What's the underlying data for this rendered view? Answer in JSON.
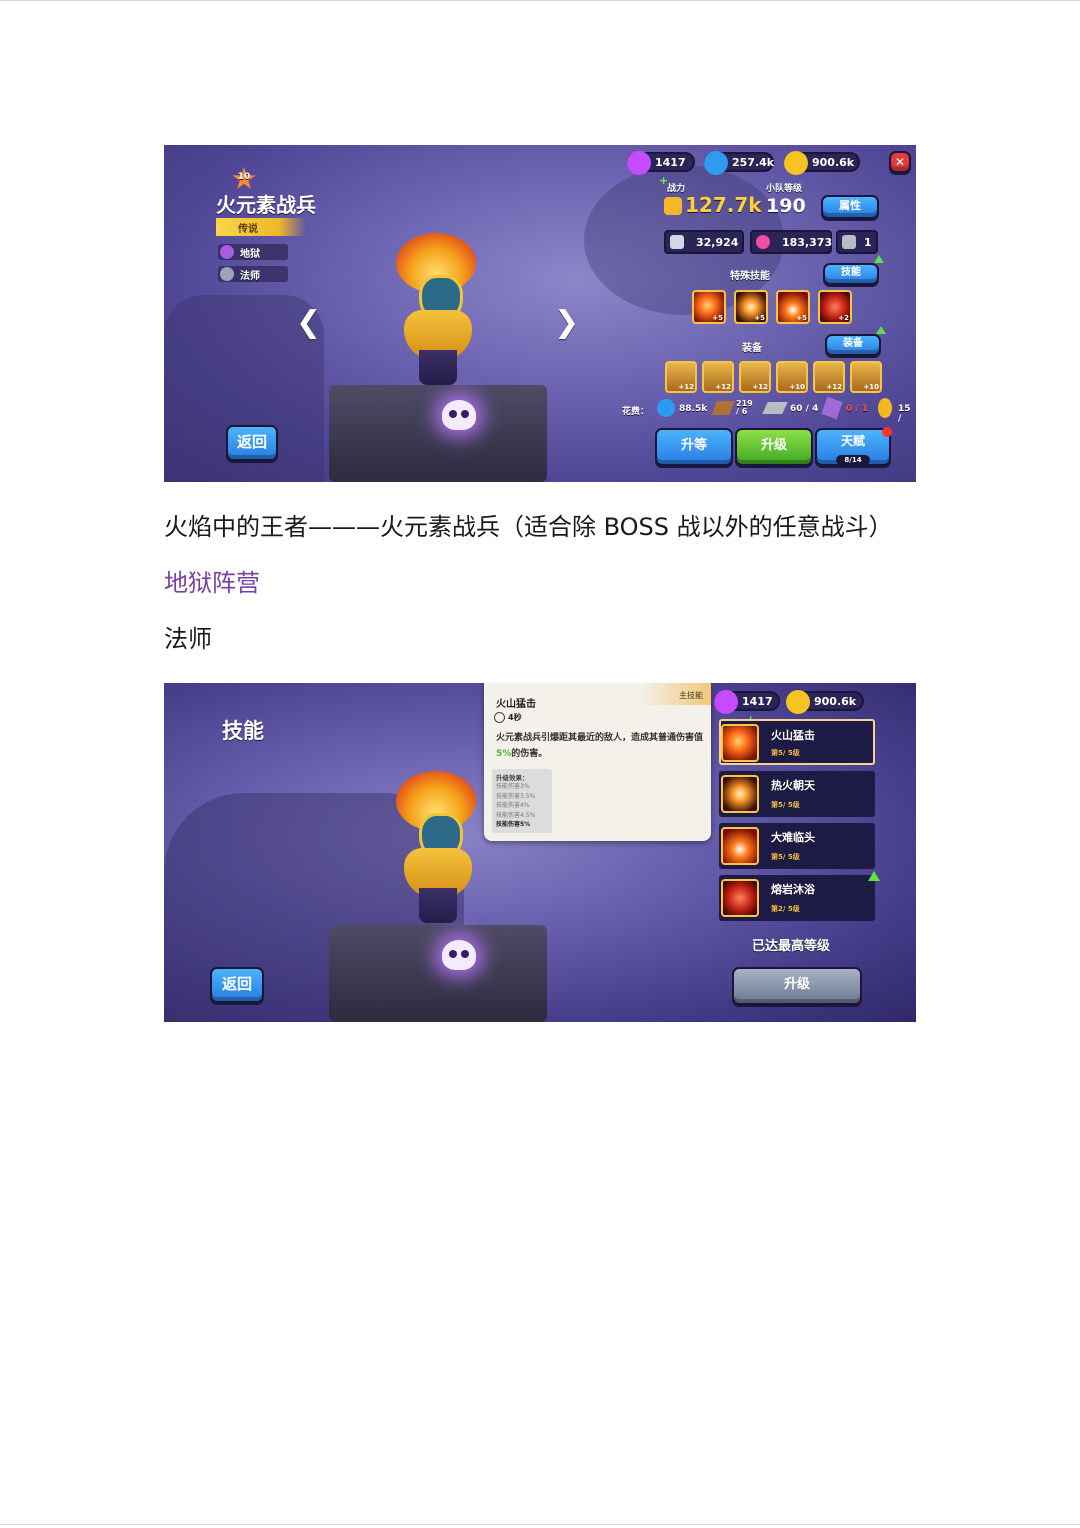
{
  "shot1": {
    "currency": {
      "gems": "1417",
      "soul": "257.4k",
      "gold": "900.6k"
    },
    "hero": {
      "star_level": "10",
      "name": "火元素战兵",
      "rarity": "传说",
      "faction": "地狱",
      "class": "法师"
    },
    "stats": {
      "power_label": "战力",
      "power": "127.7k",
      "team_level_label": "小队等级",
      "team_level": "190",
      "attr_button": "属性",
      "hp1": "32,924",
      "hp2": "183,373",
      "armor": "1"
    },
    "skills": {
      "heading": "特殊技能",
      "button": "技能",
      "icon_badges": [
        "+5",
        "+5",
        "+5",
        "+2"
      ]
    },
    "equipment": {
      "heading": "装备",
      "button": "装备",
      "icon_badges": [
        "+12",
        "+12",
        "+12",
        "+10",
        "+12",
        "+10"
      ]
    },
    "cost": {
      "label": "花费：",
      "c1": "88.5k",
      "c2": "219 / 6",
      "c3": "60 / 4",
      "c4": "0 / 1",
      "c5": "15 /"
    },
    "buttons": {
      "back": "返回",
      "rank_up": "升等",
      "level_up": "升级",
      "talent": "天赋",
      "talent_progress": "8/14"
    },
    "nav": {
      "prev": "❮",
      "next": "❯",
      "close": "✕"
    }
  },
  "caption1": "火焰中的王者———火元素战兵（适合除 BOSS 战以外的任意战斗）",
  "caption2": "地狱阵营",
  "caption3": "法师",
  "shot2": {
    "title": "技能",
    "currency": {
      "gems": "1417",
      "gold": "900.6k"
    },
    "tooltip": {
      "name": "火山猛击",
      "tag": "主技能",
      "cooldown": "4秒",
      "desc_prefix": "火元素战兵引爆距其最近的敌人，造成其普通伤害值",
      "desc_pct": "5%",
      "desc_suffix": "的伤害。",
      "upgrade_heading": "升级效果：",
      "upgrades": [
        "技能伤害3%",
        "技能伤害3.5%",
        "技能伤害4%",
        "技能伤害4.5%",
        "技能伤害5%"
      ]
    },
    "skill_list": [
      {
        "name": "火山猛击",
        "level": "第5/ 5级"
      },
      {
        "name": "热火朝天",
        "level": "第5/ 5级"
      },
      {
        "name": "大难临头",
        "level": "第5/ 5级"
      },
      {
        "name": "熔岩沐浴",
        "level": "第2/ 5级"
      }
    ],
    "max_text": "已达最高等级",
    "upgrade_button": "升级",
    "back": "返回"
  }
}
